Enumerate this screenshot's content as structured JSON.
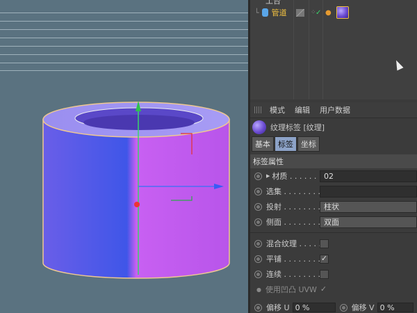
{
  "object_manager": {
    "row_top_label": "工台",
    "row_pipe_label": "管道"
  },
  "attributes": {
    "menu": [
      "模式",
      "编辑",
      "用户数据"
    ],
    "tag_title": "纹理标签 [纹理]",
    "tabs": [
      {
        "label": "基本",
        "active": false
      },
      {
        "label": "标签",
        "active": true
      },
      {
        "label": "坐标",
        "active": false
      }
    ],
    "section_title": "标签属性",
    "material_label": "材质 . . . . . . . .",
    "material_value": "02",
    "selection_label": "选集 . . . . . . . .",
    "projection_label": "投射 . . . . . . . .",
    "projection_value": "柱状",
    "side_label": "侧面 . . . . . . . .",
    "side_value": "双面",
    "mix_label": "混合纹理 . . . . .",
    "tile_label": "平铺 . . . . . . . .",
    "seamless_label": "连续 . . . . . . . .",
    "bump_uvw_label": "使用凹凸 UVW",
    "offset_u_label": "偏移 U",
    "offset_u_value": "0 %",
    "offset_v_label": "偏移 V",
    "offset_v_value": "0 %",
    "check_mark": "✓"
  },
  "colors": {
    "viewport_bg": "#5a7280",
    "active_tab": "#8da3c8",
    "cylinder_left": "#4f5be0",
    "cylinder_right": "#c35df0",
    "selection_outline": "#f0c890"
  }
}
